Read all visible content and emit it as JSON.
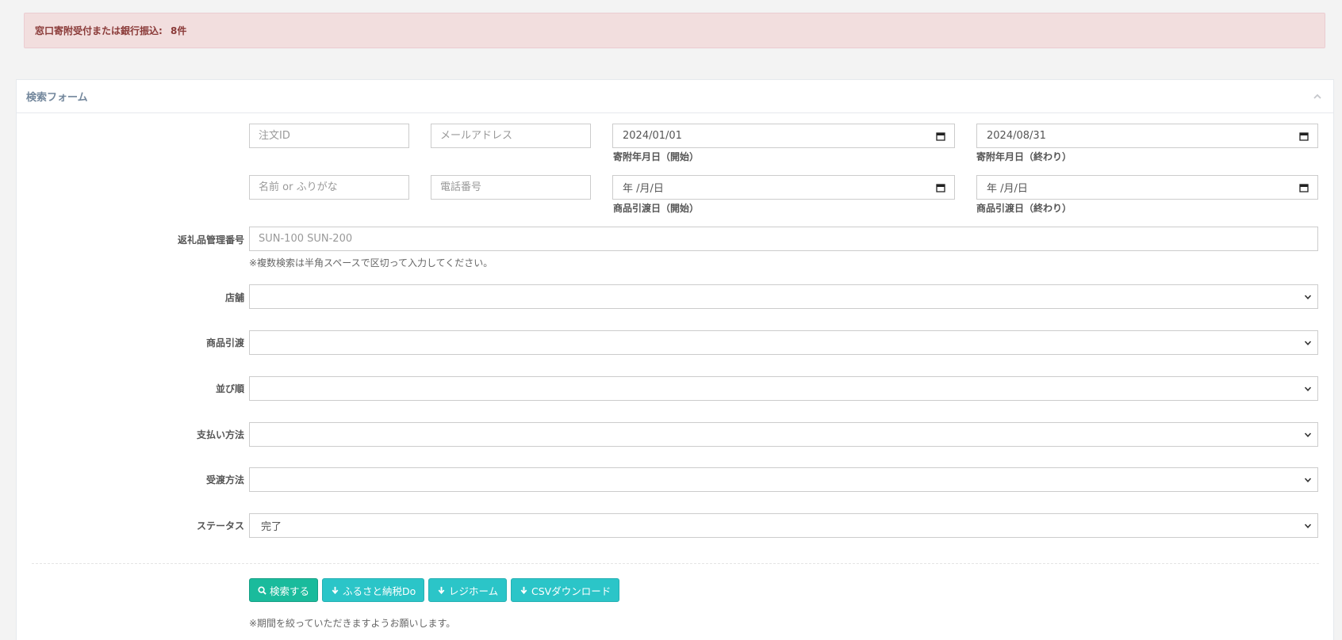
{
  "alert": {
    "label": "窓口寄附受付または銀行振込:",
    "count": "8件"
  },
  "panel": {
    "title": "検索フォーム"
  },
  "fields": {
    "order_id": {
      "placeholder": "注文ID"
    },
    "email": {
      "placeholder": "メールアドレス"
    },
    "donation_start": {
      "value": "2024/01/01",
      "label": "寄附年月日（開始）"
    },
    "donation_end": {
      "value": "2024/08/31",
      "label": "寄附年月日（終わり）"
    },
    "name": {
      "placeholder": "名前 or ふりがな"
    },
    "phone": {
      "placeholder": "電話番号"
    },
    "delivery_start": {
      "value": "年 /月/日",
      "label": "商品引渡日（開始）"
    },
    "delivery_end": {
      "value": "年 /月/日",
      "label": "商品引渡日（終わり）"
    },
    "gift_code": {
      "label": "返礼品管理番号",
      "placeholder": "SUN-100 SUN-200",
      "help": "※複数検索は半角スペースで区切って入力してください。"
    }
  },
  "selects": [
    {
      "label": "店舗",
      "value": ""
    },
    {
      "label": "商品引渡",
      "value": ""
    },
    {
      "label": "並び順",
      "value": ""
    },
    {
      "label": "支払い方法",
      "value": ""
    },
    {
      "label": "受渡方法",
      "value": ""
    },
    {
      "label": "ステータス",
      "value": "完了"
    }
  ],
  "buttons": {
    "search": "検索する",
    "furusato": "ふるさと納税Do",
    "register": "レジホーム",
    "csv": "CSVダウンロード"
  },
  "footer_note": "※期間を絞っていただきますようお願いします。",
  "colors": {
    "primary": "#1abb9c",
    "info": "#2bc5c8",
    "alert_bg": "#f2dede"
  }
}
